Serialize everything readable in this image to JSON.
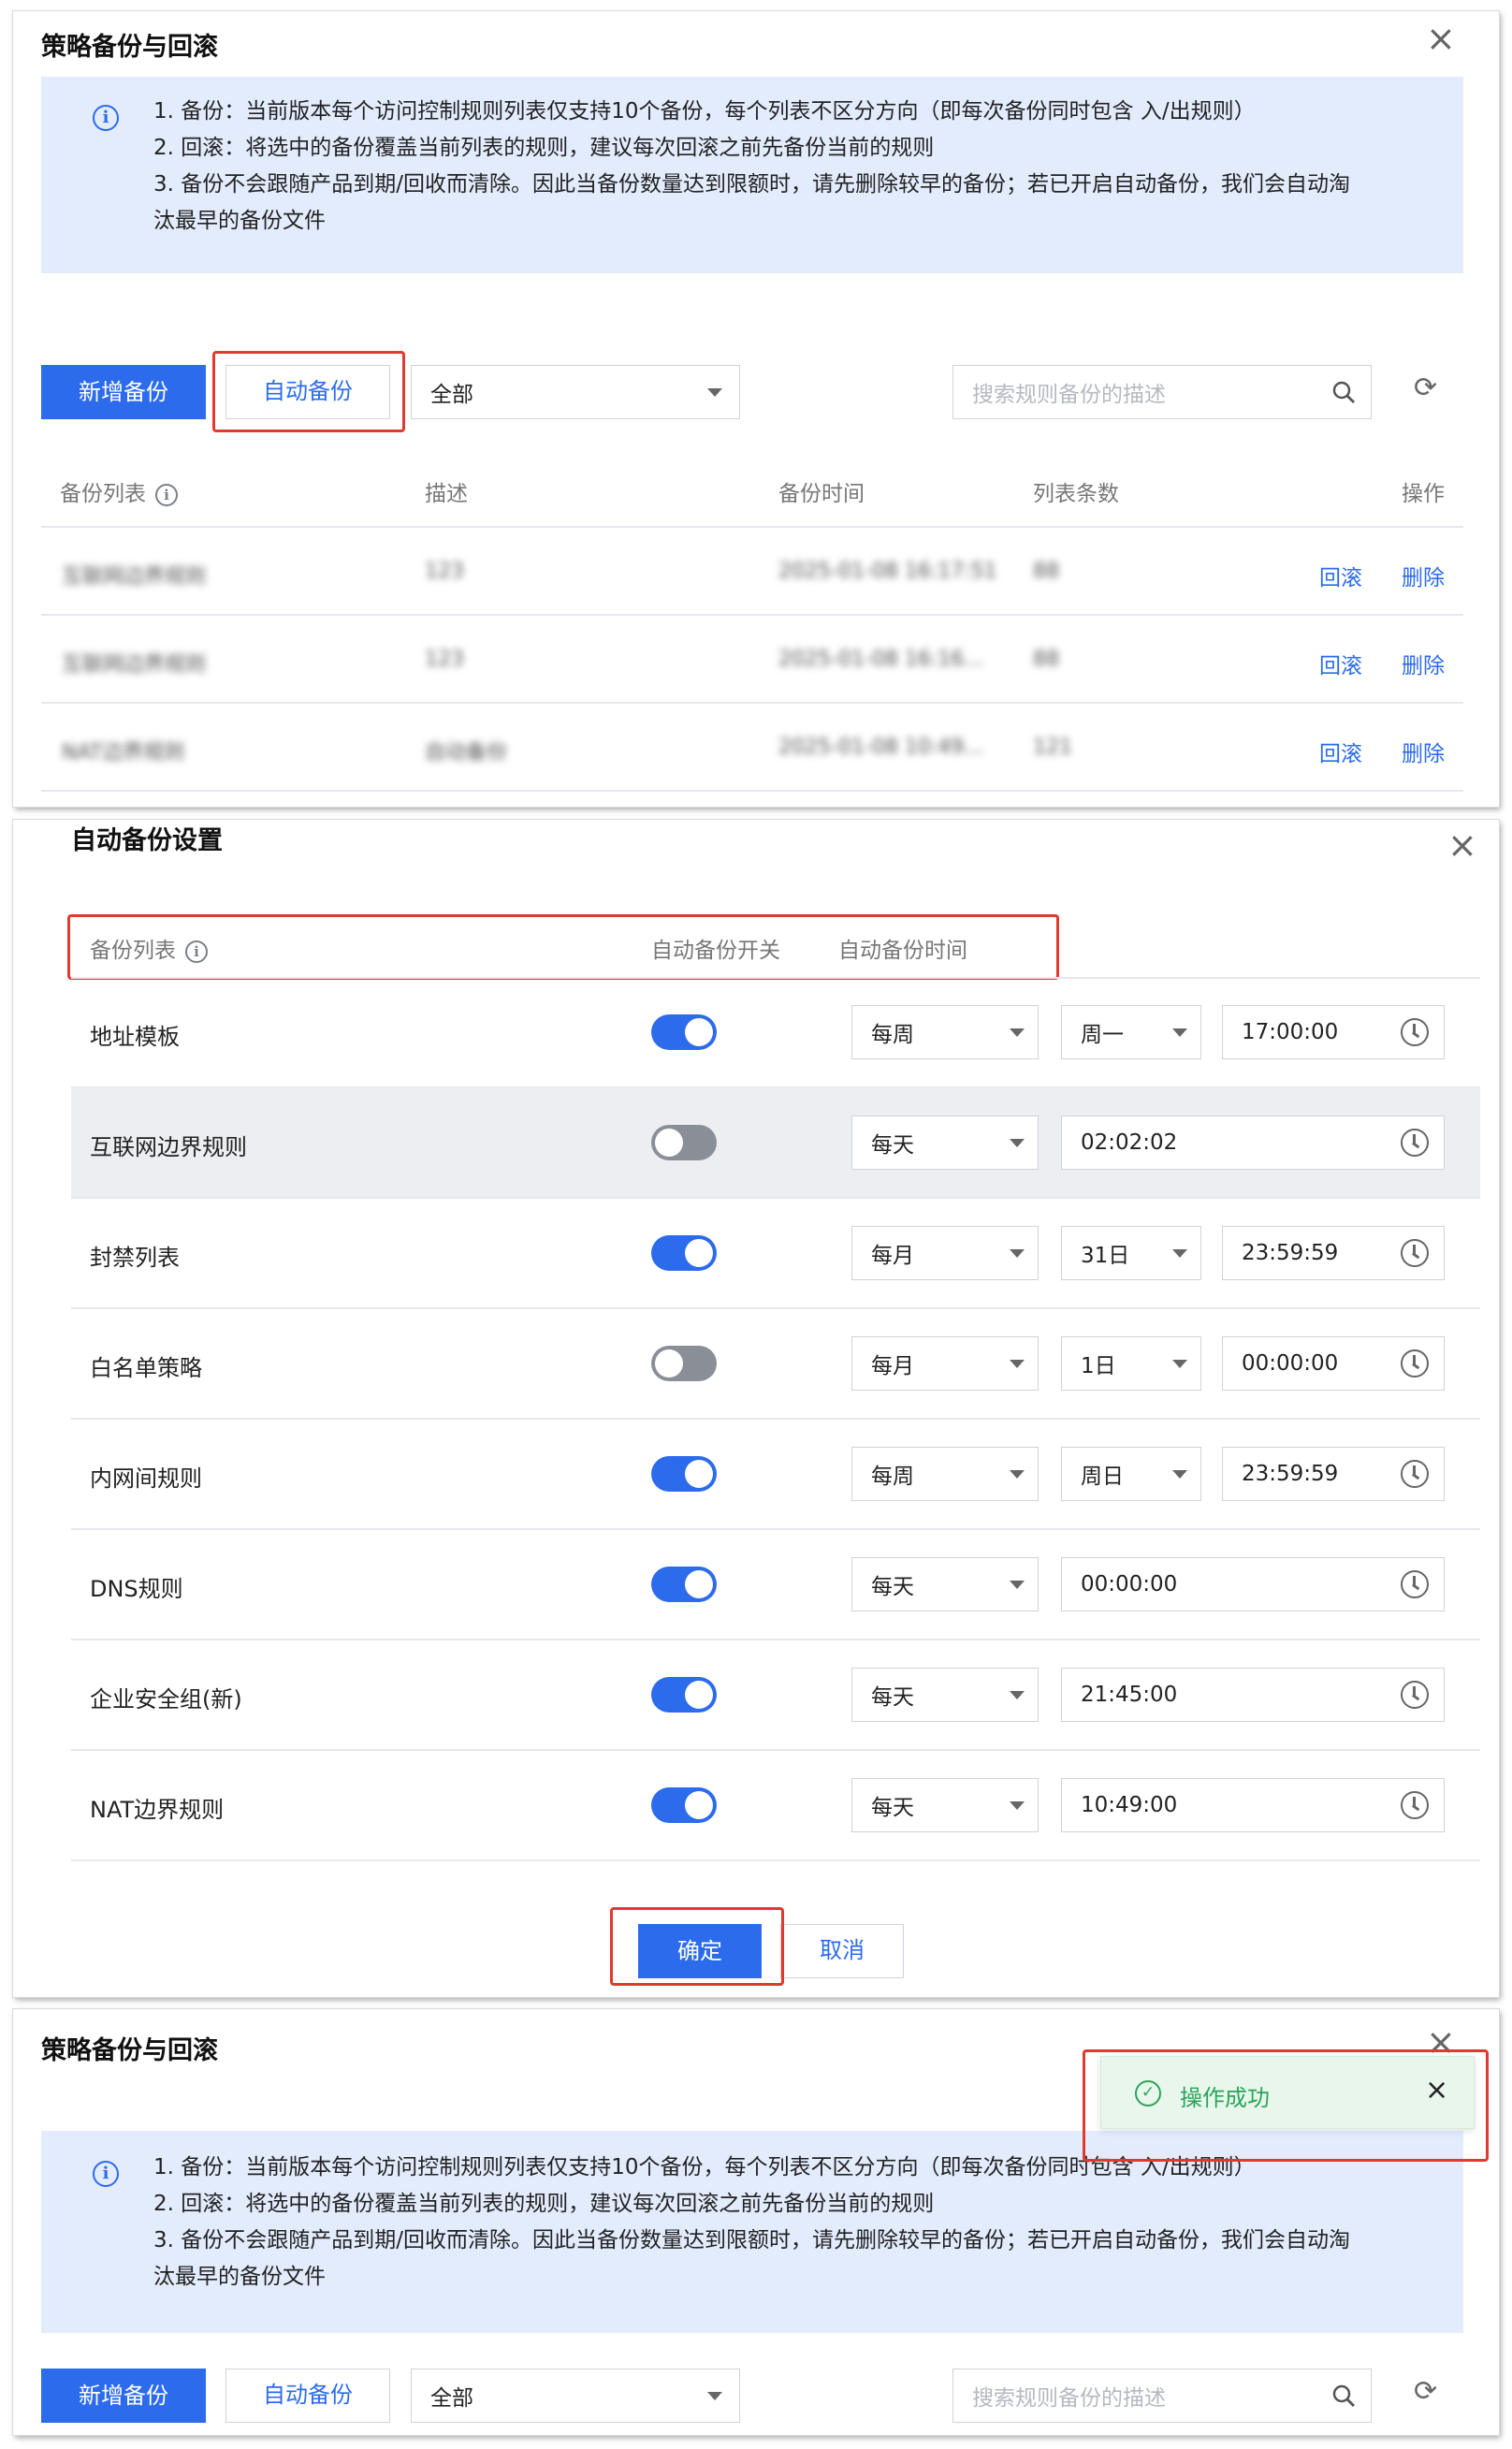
{
  "panel1": {
    "title": "策略备份与回滚",
    "notice": [
      "1. 备份：当前版本每个访问控制规则列表仅支持10个备份，每个列表不区分方向（即每次备份同时包含 入/出规则）",
      "2. 回滚：将选中的备份覆盖当前列表的规则，建议每次回滚之前先备份当前的规则",
      "3. 备份不会跟随产品到期/回收而清除。因此当备份数量达到限额时，请先删除较早的备份；若已开启自动备份，我们会自动淘",
      "汰最早的备份文件"
    ],
    "toolbar": {
      "add_label": "新增备份",
      "auto_label": "自动备份",
      "filter_value": "全部",
      "search_placeholder": "搜索规则备份的描述"
    },
    "table": {
      "headers": [
        "备份列表",
        "描述",
        "备份时间",
        "列表条数",
        "操作"
      ],
      "rows": [
        {
          "name": "互联网边界规则",
          "desc": "123",
          "time": "2025-01-08 16:17:51",
          "count": "88",
          "rollback": "回滚",
          "delete": "删除"
        },
        {
          "name": "互联网边界规则",
          "desc": "123",
          "time": "2025-01-08 16:16...",
          "count": "88",
          "rollback": "回滚",
          "delete": "删除"
        },
        {
          "name": "NAT边界规则",
          "desc": "自动备份",
          "time": "2025-01-08 10:49...",
          "count": "121",
          "rollback": "回滚",
          "delete": "删除"
        }
      ]
    }
  },
  "panel2": {
    "title": "自动备份设置",
    "headers": [
      "备份列表",
      "自动备份开关",
      "自动备份时间"
    ],
    "rows": [
      {
        "name": "地址模板",
        "enabled": true,
        "freq": "每周",
        "day": "周一",
        "time": "17:00:00",
        "highlighted": false
      },
      {
        "name": "互联网边界规则",
        "enabled": false,
        "freq": "每天",
        "day": "",
        "time": "02:02:02",
        "highlighted": true
      },
      {
        "name": "封禁列表",
        "enabled": true,
        "freq": "每月",
        "day": "31日",
        "time": "23:59:59",
        "highlighted": false
      },
      {
        "name": "白名单策略",
        "enabled": false,
        "freq": "每月",
        "day": "1日",
        "time": "00:00:00",
        "highlighted": false
      },
      {
        "name": "内网间规则",
        "enabled": true,
        "freq": "每周",
        "day": "周日",
        "time": "23:59:59",
        "highlighted": false
      },
      {
        "name": "DNS规则",
        "enabled": true,
        "freq": "每天",
        "day": "",
        "time": "00:00:00",
        "highlighted": false
      },
      {
        "name": "企业安全组(新)",
        "enabled": true,
        "freq": "每天",
        "day": "",
        "time": "21:45:00",
        "highlighted": false
      },
      {
        "name": "NAT边界规则",
        "enabled": true,
        "freq": "每天",
        "day": "",
        "time": "10:49:00",
        "highlighted": false
      }
    ],
    "confirm_label": "确定",
    "cancel_label": "取消"
  },
  "panel3": {
    "title": "策略备份与回滚",
    "toast": "操作成功",
    "notice": [
      "1. 备份：当前版本每个访问控制规则列表仅支持10个备份，每个列表不区分方向（即每次备份同时包含 入/出规则）",
      "2. 回滚：将选中的备份覆盖当前列表的规则，建议每次回滚之前先备份当前的规则",
      "3. 备份不会跟随产品到期/回收而清除。因此当备份数量达到限额时，请先删除较早的备份；若已开启自动备份，我们会自动淘",
      "汰最早的备份文件"
    ],
    "toolbar": {
      "add_label": "新增备份",
      "auto_label": "自动备份",
      "filter_value": "全部",
      "search_placeholder": "搜索规则备份的描述"
    }
  },
  "colors": {
    "primary": "#2c6bec",
    "highlight_box": "#e03a2f",
    "notice_bg": "#e3ecfd",
    "toast_bg": "#e8f6ec",
    "success": "#2ba45a"
  },
  "icons": [
    "close-icon",
    "info-icon",
    "search-icon",
    "refresh-icon",
    "chevron-down-icon",
    "clock-icon",
    "check-circle-icon"
  ]
}
